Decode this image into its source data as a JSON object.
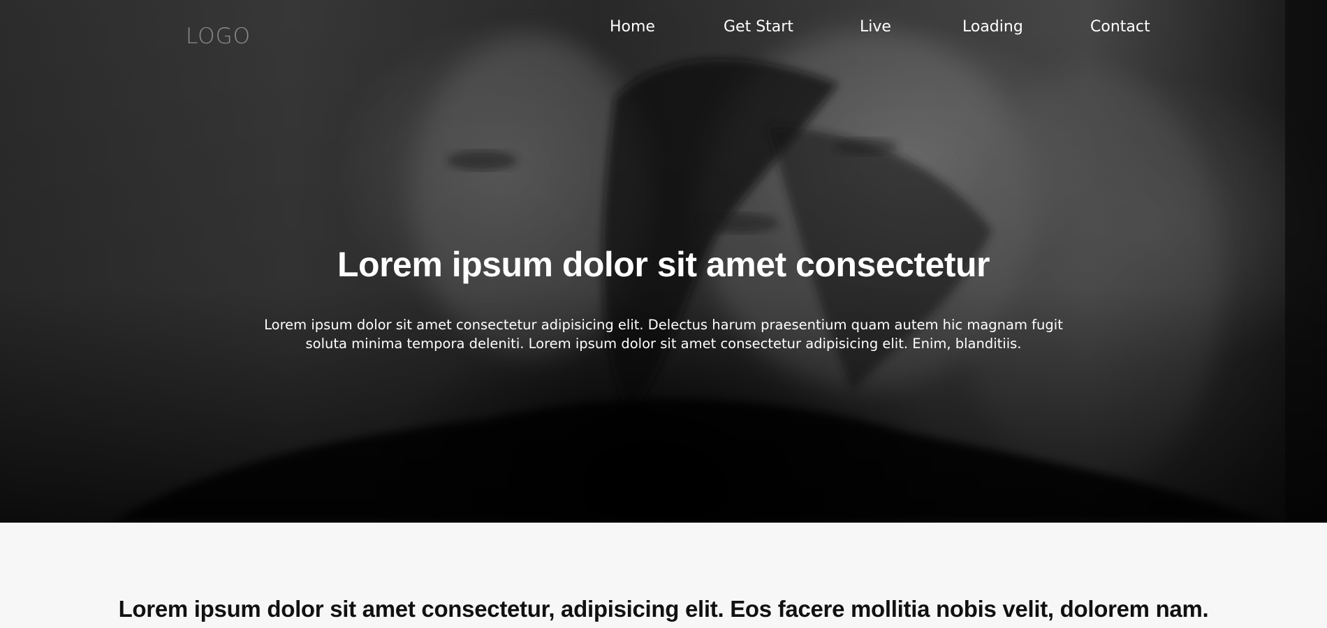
{
  "header": {
    "logo": "LOGO",
    "nav": [
      {
        "label": "Home"
      },
      {
        "label": "Get Start"
      },
      {
        "label": "Live"
      },
      {
        "label": "Loading"
      },
      {
        "label": "Contact"
      }
    ]
  },
  "hero": {
    "title": "Lorem ipsum dolor sit amet consectetur",
    "text": "Lorem ipsum dolor sit amet consectetur adipisicing elit. Delectus harum praesentium quam autem hic magnam fugit soluta minima tempora deleniti. Lorem ipsum dolor sit amet consectetur adipisicing elit. Enim, blanditiis."
  },
  "section": {
    "heading": "Lorem ipsum dolor sit amet consectetur, adipisicing elit. Eos facere mollitia nobis velit, dolorem nam."
  },
  "colors": {
    "page_background": "#f7f7f7",
    "hero_text": "#ffffff",
    "logo": "#8e8e8e",
    "heading_text": "#111111"
  }
}
